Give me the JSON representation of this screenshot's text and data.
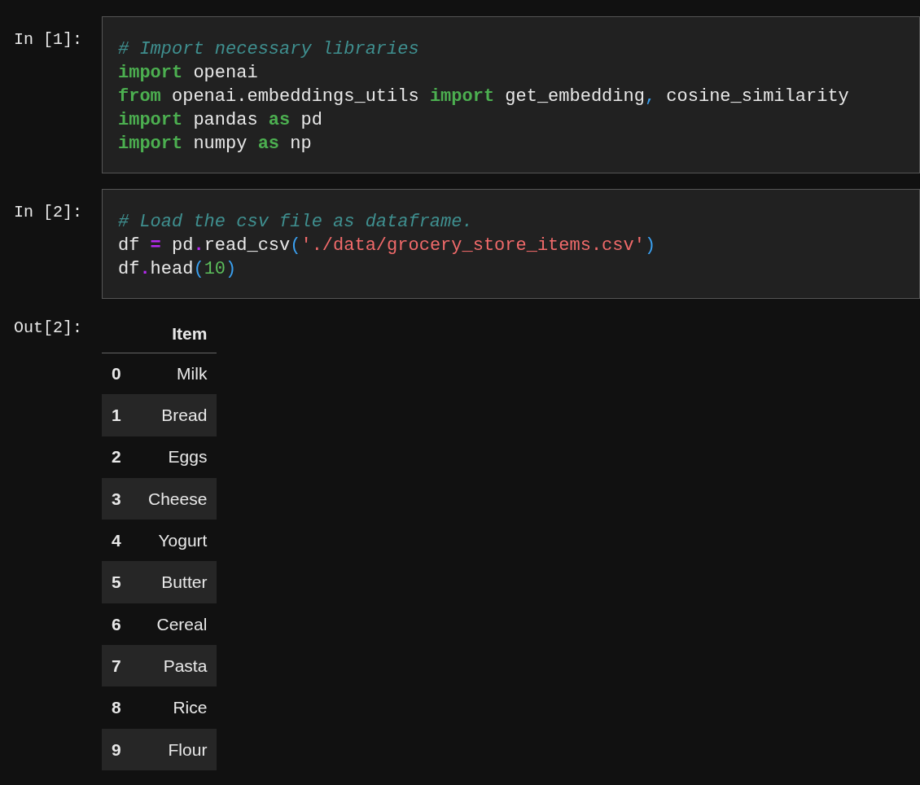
{
  "cells": [
    {
      "prompt": "In [1]:",
      "lines": [
        [
          {
            "kind": "comment",
            "text": "# Import necessary libraries"
          }
        ],
        [
          {
            "kind": "keyword",
            "text": "import"
          },
          {
            "kind": "plain",
            "text": " openai"
          }
        ],
        [
          {
            "kind": "keyword",
            "text": "from"
          },
          {
            "kind": "plain",
            "text": " openai.embeddings_utils "
          },
          {
            "kind": "keyword",
            "text": "import"
          },
          {
            "kind": "plain",
            "text": " get_embedding"
          },
          {
            "kind": "punct",
            "text": ","
          },
          {
            "kind": "plain",
            "text": " cosine_similarity"
          }
        ],
        [
          {
            "kind": "keyword",
            "text": "import"
          },
          {
            "kind": "plain",
            "text": " pandas "
          },
          {
            "kind": "keyword",
            "text": "as"
          },
          {
            "kind": "plain",
            "text": " pd"
          }
        ],
        [
          {
            "kind": "keyword",
            "text": "import"
          },
          {
            "kind": "plain",
            "text": " numpy "
          },
          {
            "kind": "keyword",
            "text": "as"
          },
          {
            "kind": "plain",
            "text": " np"
          }
        ]
      ]
    },
    {
      "prompt": "In [2]:",
      "lines": [
        [
          {
            "kind": "comment",
            "text": "# Load the csv file as dataframe."
          }
        ],
        [
          {
            "kind": "plain",
            "text": "df "
          },
          {
            "kind": "operator",
            "text": "="
          },
          {
            "kind": "plain",
            "text": " pd"
          },
          {
            "kind": "operator",
            "text": "."
          },
          {
            "kind": "plain",
            "text": "read_csv"
          },
          {
            "kind": "paren",
            "text": "("
          },
          {
            "kind": "string",
            "text": "'./data/grocery_store_items.csv'"
          },
          {
            "kind": "paren",
            "text": ")"
          }
        ],
        [
          {
            "kind": "plain",
            "text": "df"
          },
          {
            "kind": "operator",
            "text": "."
          },
          {
            "kind": "plain",
            "text": "head"
          },
          {
            "kind": "paren",
            "text": "("
          },
          {
            "kind": "number",
            "text": "10"
          },
          {
            "kind": "paren",
            "text": ")"
          }
        ]
      ]
    }
  ],
  "output": {
    "prompt": "Out[2]:",
    "columns": [
      "",
      "Item"
    ],
    "rows": [
      [
        "0",
        "Milk"
      ],
      [
        "1",
        "Bread"
      ],
      [
        "2",
        "Eggs"
      ],
      [
        "3",
        "Cheese"
      ],
      [
        "4",
        "Yogurt"
      ],
      [
        "5",
        "Butter"
      ],
      [
        "6",
        "Cereal"
      ],
      [
        "7",
        "Pasta"
      ],
      [
        "8",
        "Rice"
      ],
      [
        "9",
        "Flour"
      ]
    ]
  }
}
